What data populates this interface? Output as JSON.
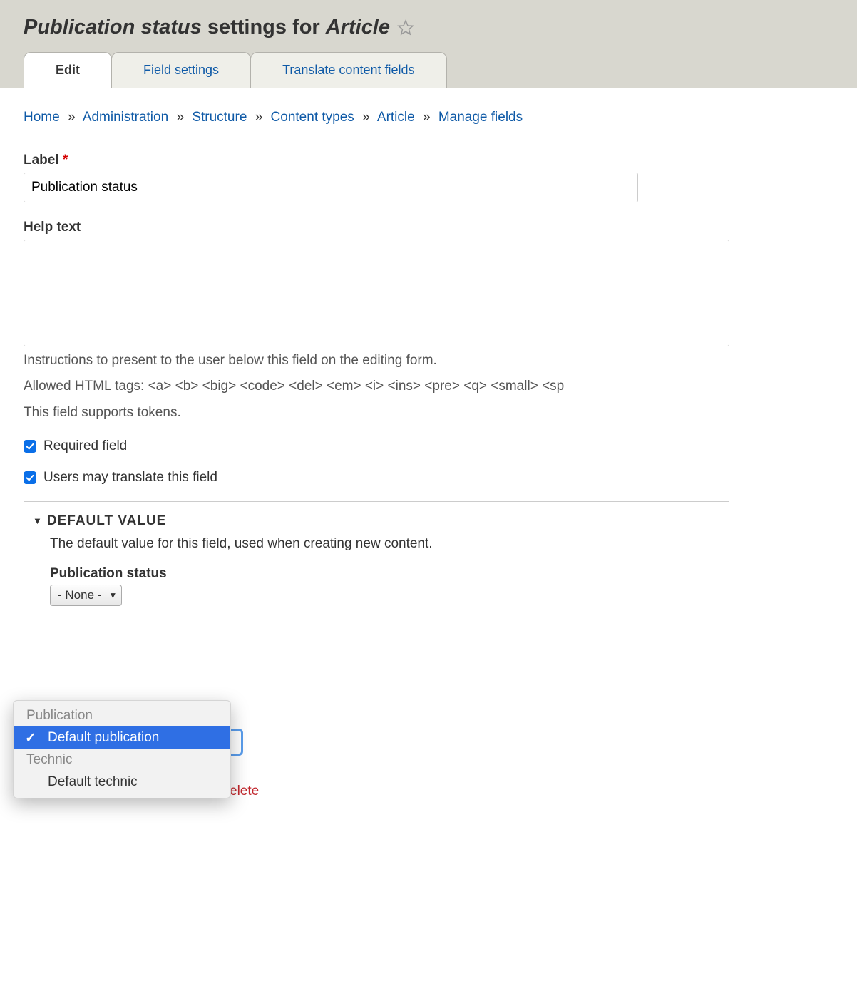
{
  "header": {
    "title_prefix_italic": "Publication status",
    "title_mid": " settings for ",
    "title_suffix_italic": "Article"
  },
  "tabs": {
    "edit": "Edit",
    "field_settings": "Field settings",
    "translate": "Translate content fields"
  },
  "breadcrumb": {
    "home": "Home",
    "admin": "Administration",
    "structure": "Structure",
    "content_types": "Content types",
    "article": "Article",
    "manage_fields": "Manage fields"
  },
  "form": {
    "label_label": "Label",
    "label_value": "Publication status",
    "help_label": "Help text",
    "help_value": "",
    "help_desc1": "Instructions to present to the user below this field on the editing form.",
    "help_desc2": "Allowed HTML tags: <a> <b> <big> <code> <del> <em> <i> <ins> <pre> <q> <small> <sp",
    "help_desc3": "This field supports tokens.",
    "required_label": "Required field",
    "translate_label": "Users may translate this field"
  },
  "fieldset": {
    "legend": "DEFAULT VALUE",
    "description": "The default value for this field, used when creating new content.",
    "sub_label": "Publication status",
    "select_value": "- None -"
  },
  "dropdown": {
    "group1": "Publication",
    "option1": "Default publication",
    "group2": "Technic",
    "option2": "Default technic"
  },
  "actions": {
    "delete": "elete"
  }
}
